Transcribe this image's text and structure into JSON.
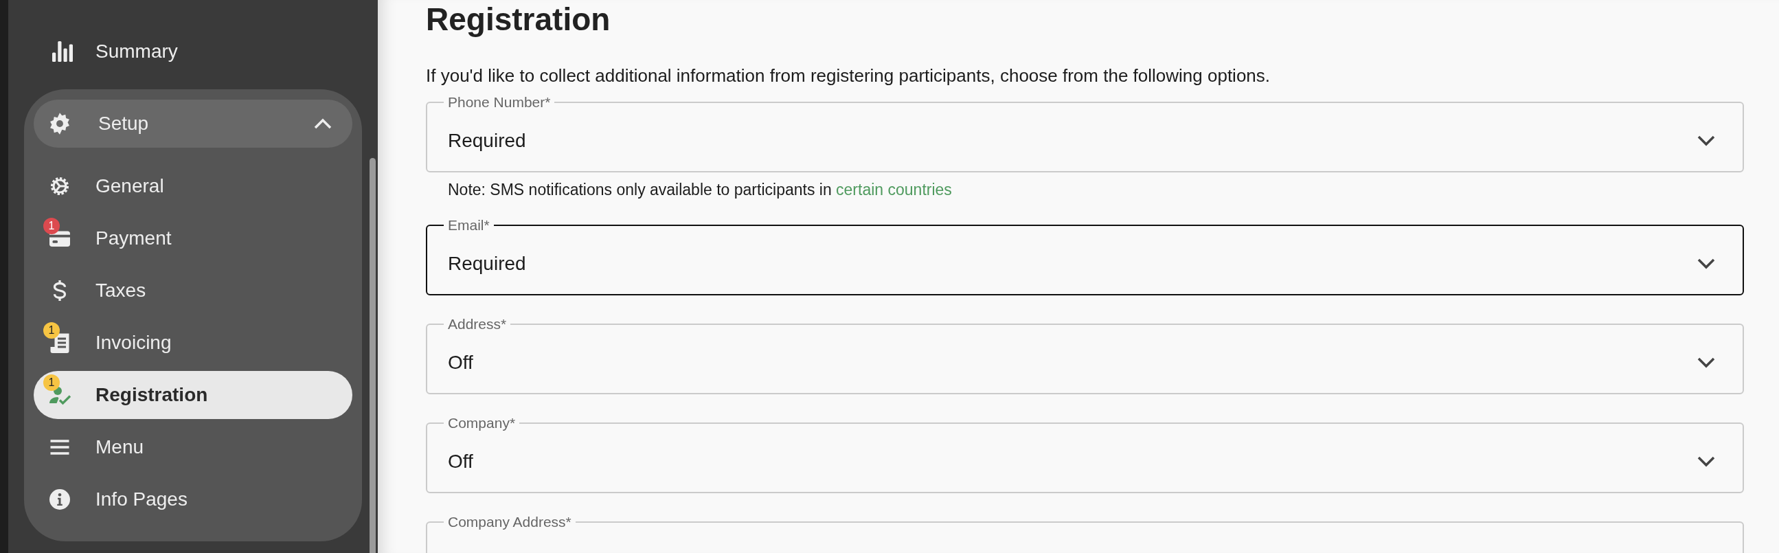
{
  "sidebar": {
    "top_item": {
      "label": "Summary"
    },
    "group": {
      "label": "Setup",
      "expanded": true,
      "items": [
        {
          "label": "General",
          "selected": false
        },
        {
          "label": "Payment",
          "selected": false,
          "badge": {
            "count": "1",
            "color": "#dc4a4f"
          }
        },
        {
          "label": "Taxes",
          "selected": false
        },
        {
          "label": "Invoicing",
          "selected": false,
          "badge": {
            "count": "1",
            "color": "#f6c443"
          }
        },
        {
          "label": "Registration",
          "selected": true,
          "badge": {
            "count": "1",
            "color": "#f6c443"
          }
        },
        {
          "label": "Menu",
          "selected": false
        },
        {
          "label": "Info Pages",
          "selected": false
        }
      ]
    }
  },
  "main": {
    "title": "Registration",
    "description": "If you'd like to collect additional information from registering participants, choose from the following options.",
    "fields": [
      {
        "label": "Phone Number*",
        "value": "Required",
        "focused": false,
        "note": {
          "text": "Note: SMS notifications only available to participants in",
          "link": "certain countries"
        }
      },
      {
        "label": "Email*",
        "value": "Required",
        "focused": true
      },
      {
        "label": "Address*",
        "value": "Off",
        "focused": false
      },
      {
        "label": "Company*",
        "value": "Off",
        "focused": false
      },
      {
        "label": "Company Address*",
        "focused": false
      }
    ]
  }
}
